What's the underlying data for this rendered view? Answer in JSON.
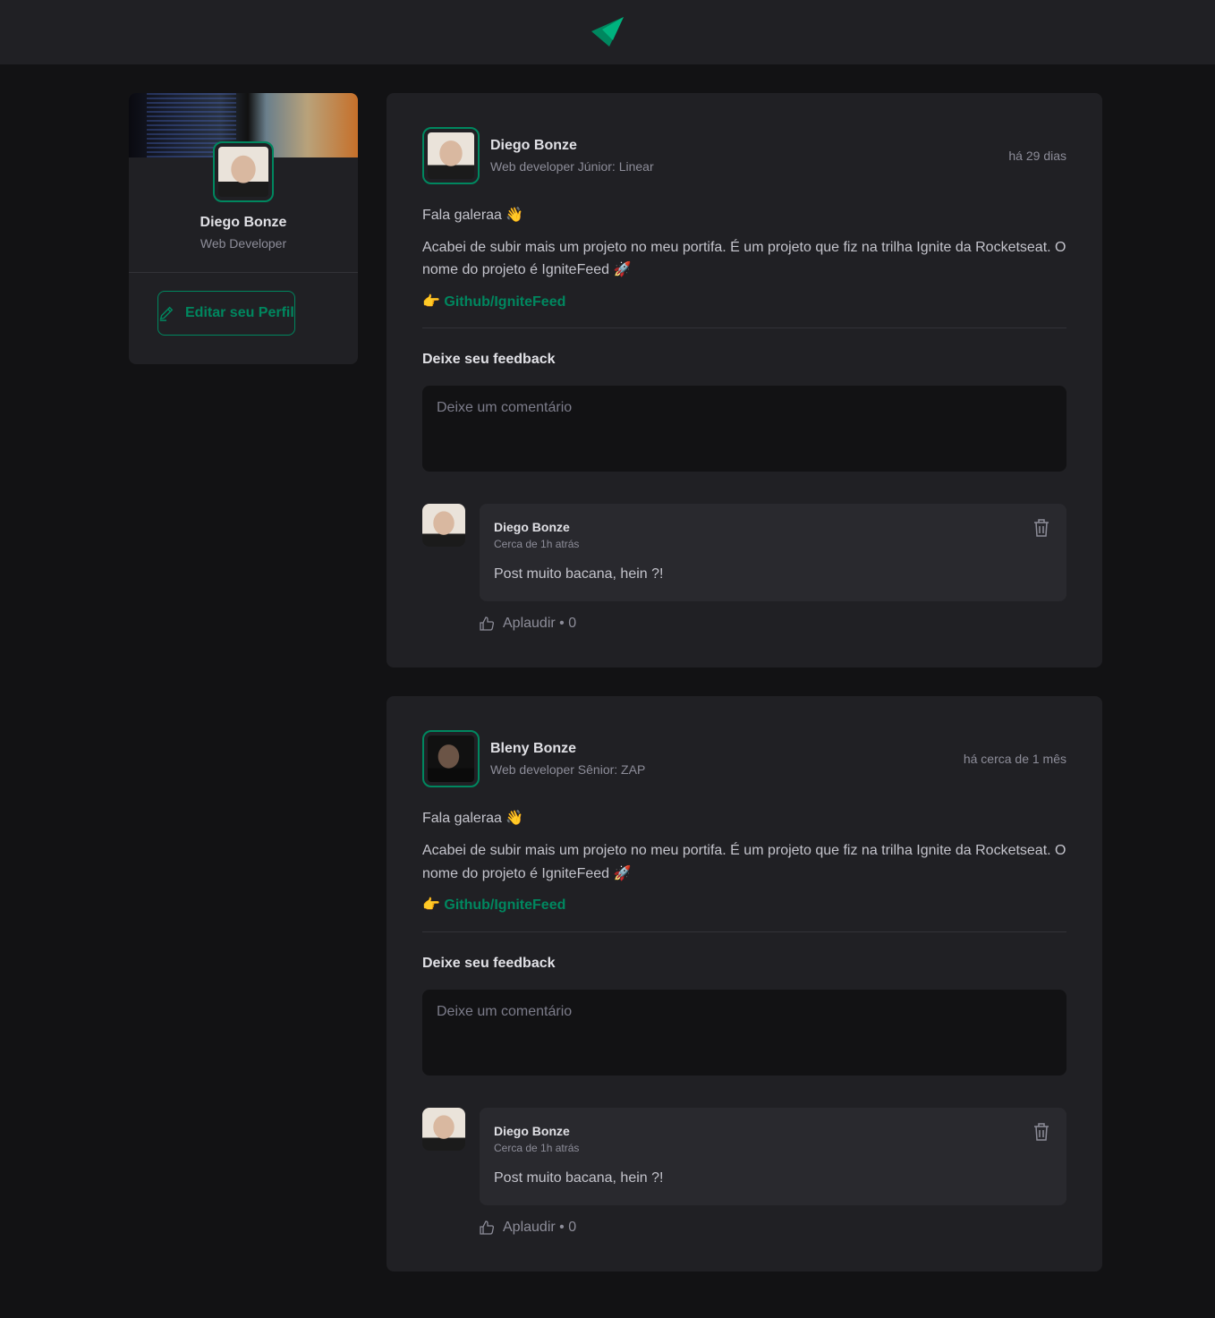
{
  "brand": {
    "accent": "#00875f",
    "logo": "ignite-logo"
  },
  "sidebar": {
    "name": "Diego Bonze",
    "role": "Web Developer",
    "edit_label": "Editar seu Perfil"
  },
  "posts": [
    {
      "author": "Diego Bonze",
      "role": "Web developer Júnior: Linear",
      "time": "há 29 dias",
      "greeting": "Fala galeraa 👋",
      "body": "Acabei de subir mais um projeto no meu portifa. É um projeto que fiz na trilha Ignite da Rocketseat. O nome do projeto é IgniteFeed 🚀",
      "link_emoji": "👉",
      "link": "Github/IgniteFeed",
      "feedback_title": "Deixe seu feedback",
      "placeholder": "Deixe um comentário",
      "comment": {
        "author": "Diego Bonze",
        "time": "Cerca de 1h atrás",
        "text": "Post muito bacana, hein ?!",
        "applaud": "Aplaudir • 0"
      }
    },
    {
      "author": "Bleny Bonze",
      "role": "Web developer Sênior: ZAP",
      "time": "há cerca de 1 mês",
      "greeting": "Fala galeraa 👋",
      "body": "Acabei de subir mais um projeto no meu portifa. É um projeto que fiz na trilha Ignite da Rocketseat. O nome do projeto é IgniteFeed 🚀",
      "link_emoji": "👉",
      "link": "Github/IgniteFeed",
      "feedback_title": "Deixe seu feedback",
      "placeholder": "Deixe um comentário",
      "comment": {
        "author": "Diego Bonze",
        "time": "Cerca de 1h atrás",
        "text": "Post muito bacana, hein ?!",
        "applaud": "Aplaudir • 0"
      }
    }
  ]
}
